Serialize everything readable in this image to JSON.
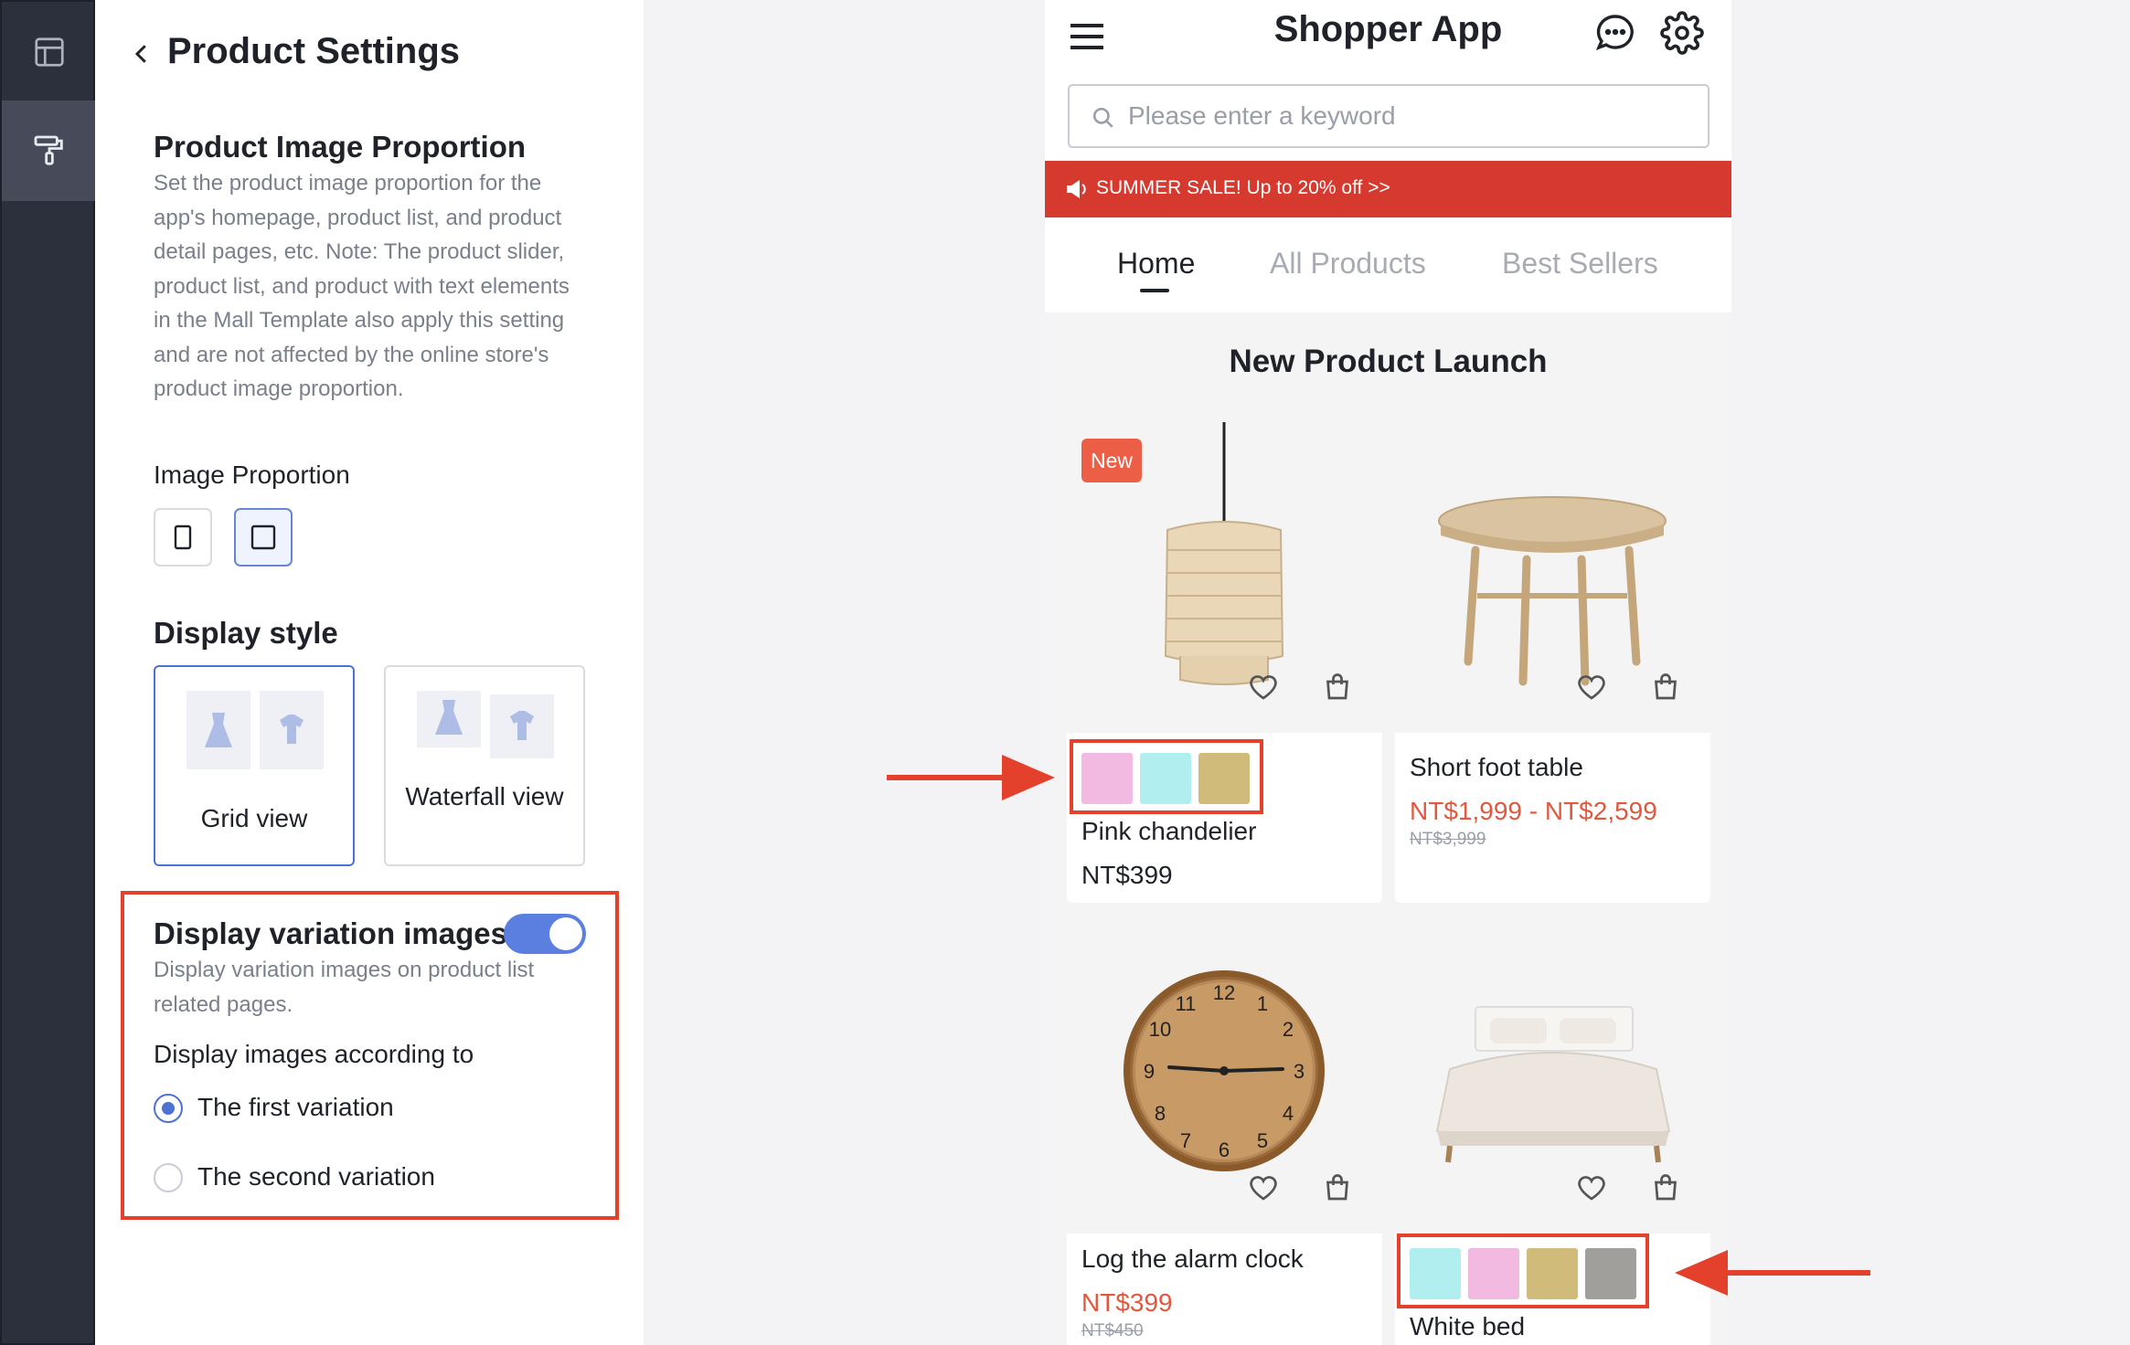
{
  "page": {
    "title": "Product Settings"
  },
  "product_image_proportion": {
    "heading": "Product Image Proportion",
    "description": "Set the product image proportion for the app's homepage, product list, and product detail pages, etc. Note: The product slider, product list, and product with text elements in the Mall Template also apply this setting and are not affected by the online store's product image proportion.",
    "label": "Image Proportion",
    "options": [
      {
        "icon": "portrait-ratio-icon",
        "selected": false
      },
      {
        "icon": "square-ratio-icon",
        "selected": true
      }
    ]
  },
  "display_style": {
    "heading": "Display style",
    "options": [
      {
        "label": "Grid view",
        "selected": true
      },
      {
        "label": "Waterfall view",
        "selected": false
      }
    ]
  },
  "variation_images": {
    "heading": "Display variation images",
    "enabled": true,
    "description": "Display variation images on product list related pages.",
    "according_label": "Display images according to",
    "radios": [
      {
        "label": "The first variation",
        "checked": true
      },
      {
        "label": "The second variation",
        "checked": false
      }
    ]
  },
  "preview": {
    "app_title": "Shopper App",
    "search_placeholder": "Please enter a keyword",
    "banner": "SUMMER SALE! Up to 20% off >>",
    "tabs": [
      "Home",
      "All Products",
      "Best Sellers"
    ],
    "active_tab": "Home",
    "section_title": "New Product Launch",
    "products": [
      {
        "name": "Pink chandelier",
        "price": "NT$399",
        "original_price": "",
        "badge": "New",
        "swatches": [
          "#f2b9e1",
          "#b1eef0",
          "#d1bb7a"
        ]
      },
      {
        "name": "Short foot table",
        "price": "NT$1,999 - NT$2,599",
        "original_price": "NT$3,999",
        "badge": "",
        "swatches": []
      },
      {
        "name": "Log the alarm clock",
        "price": "NT$399",
        "original_price": "NT$450",
        "badge": "",
        "swatches": []
      },
      {
        "name": "White bed",
        "price": "",
        "original_price": "",
        "badge": "",
        "swatches": [
          "#b1eef0",
          "#f2b9e1",
          "#d1bb7a",
          "#a19f9c"
        ]
      }
    ]
  },
  "colors": {
    "accent": "#4d72d4",
    "highlight_red": "#e3412c",
    "banner_red": "#d63a2f",
    "sale_price": "#e2583e"
  }
}
